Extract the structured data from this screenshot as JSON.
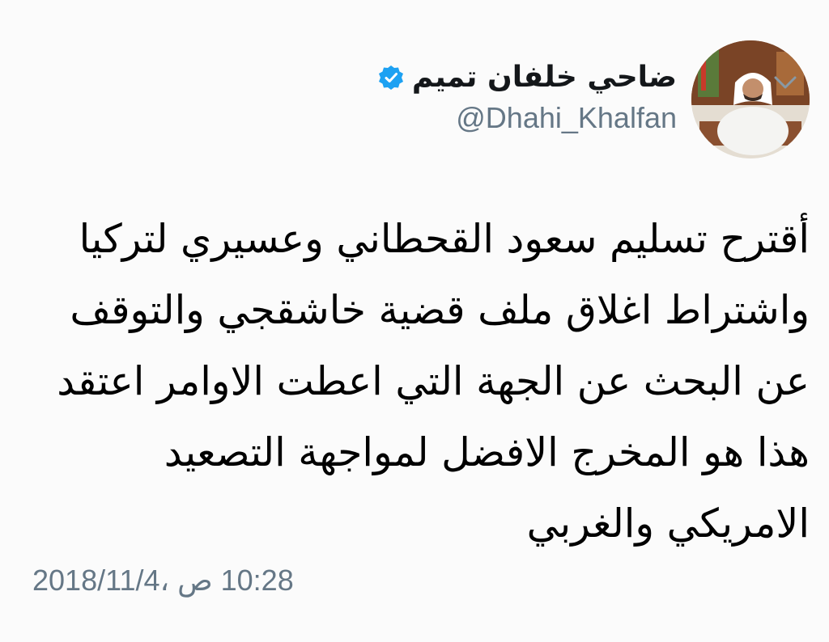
{
  "tweet": {
    "display_name": "ضاحي خلفان تميم",
    "handle": "@Dhahi_Khalfan",
    "body": "أقترح تسليم سعود القحطاني وعسيري لتركيا\nواشتراط اغلاق ملف قضية خاشقجي والتوقف\nعن البحث عن الجهة التي اعطت الاوامر اعتقد\nهذا هو المخرج الافضل لمواجهة التصعيد\nالامريكي والغربي",
    "timestamp": "10:28 ص ،2018/11/4"
  },
  "icons": {
    "verified": "verified-badge-icon",
    "caret": "chevron-down-icon"
  },
  "colors": {
    "verified_blue": "#1da1f2",
    "secondary_text": "#657786",
    "primary_text": "#14171a"
  }
}
